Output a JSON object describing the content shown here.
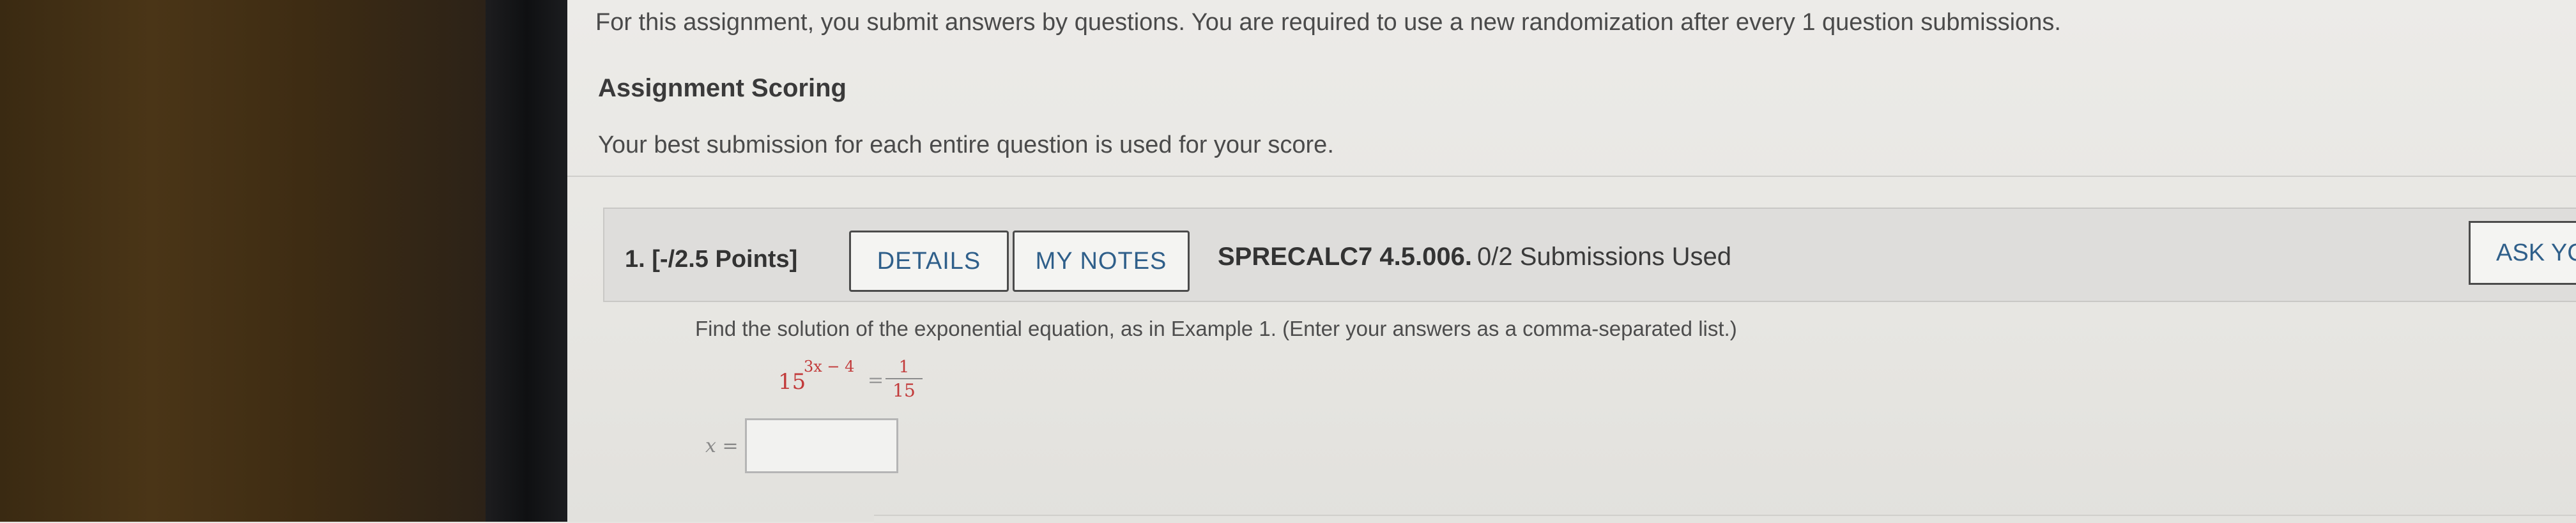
{
  "intro": {
    "text": "For this assignment, you submit answers by questions. You are required to use a new randomization after every 1 question submissions.",
    "scoring_heading": "Assignment Scoring",
    "scoring_text": "Your best submission for each entire question is used for your score."
  },
  "question": {
    "number_points": "1.  [-/2.5 Points]",
    "details_label": "DETAILS",
    "my_notes_label": "MY NOTES",
    "code": "SPRECALC7 4.5.006.",
    "submissions": "0/2 Submissions Used",
    "ask_label": "ASK YC",
    "prompt": "Find the solution of the exponential equation, as in Example 1. (Enter your answers as a comma-separated list.)",
    "equation": {
      "base": "15",
      "exponent": "3x − 4",
      "equals": "=",
      "numerator": "1",
      "denominator": "15"
    },
    "answer_label": "x =",
    "answer_value": ""
  },
  "colors": {
    "accent_link": "#2f5f8a",
    "math_red": "#c23a3a",
    "header_bg": "#dedddb"
  }
}
